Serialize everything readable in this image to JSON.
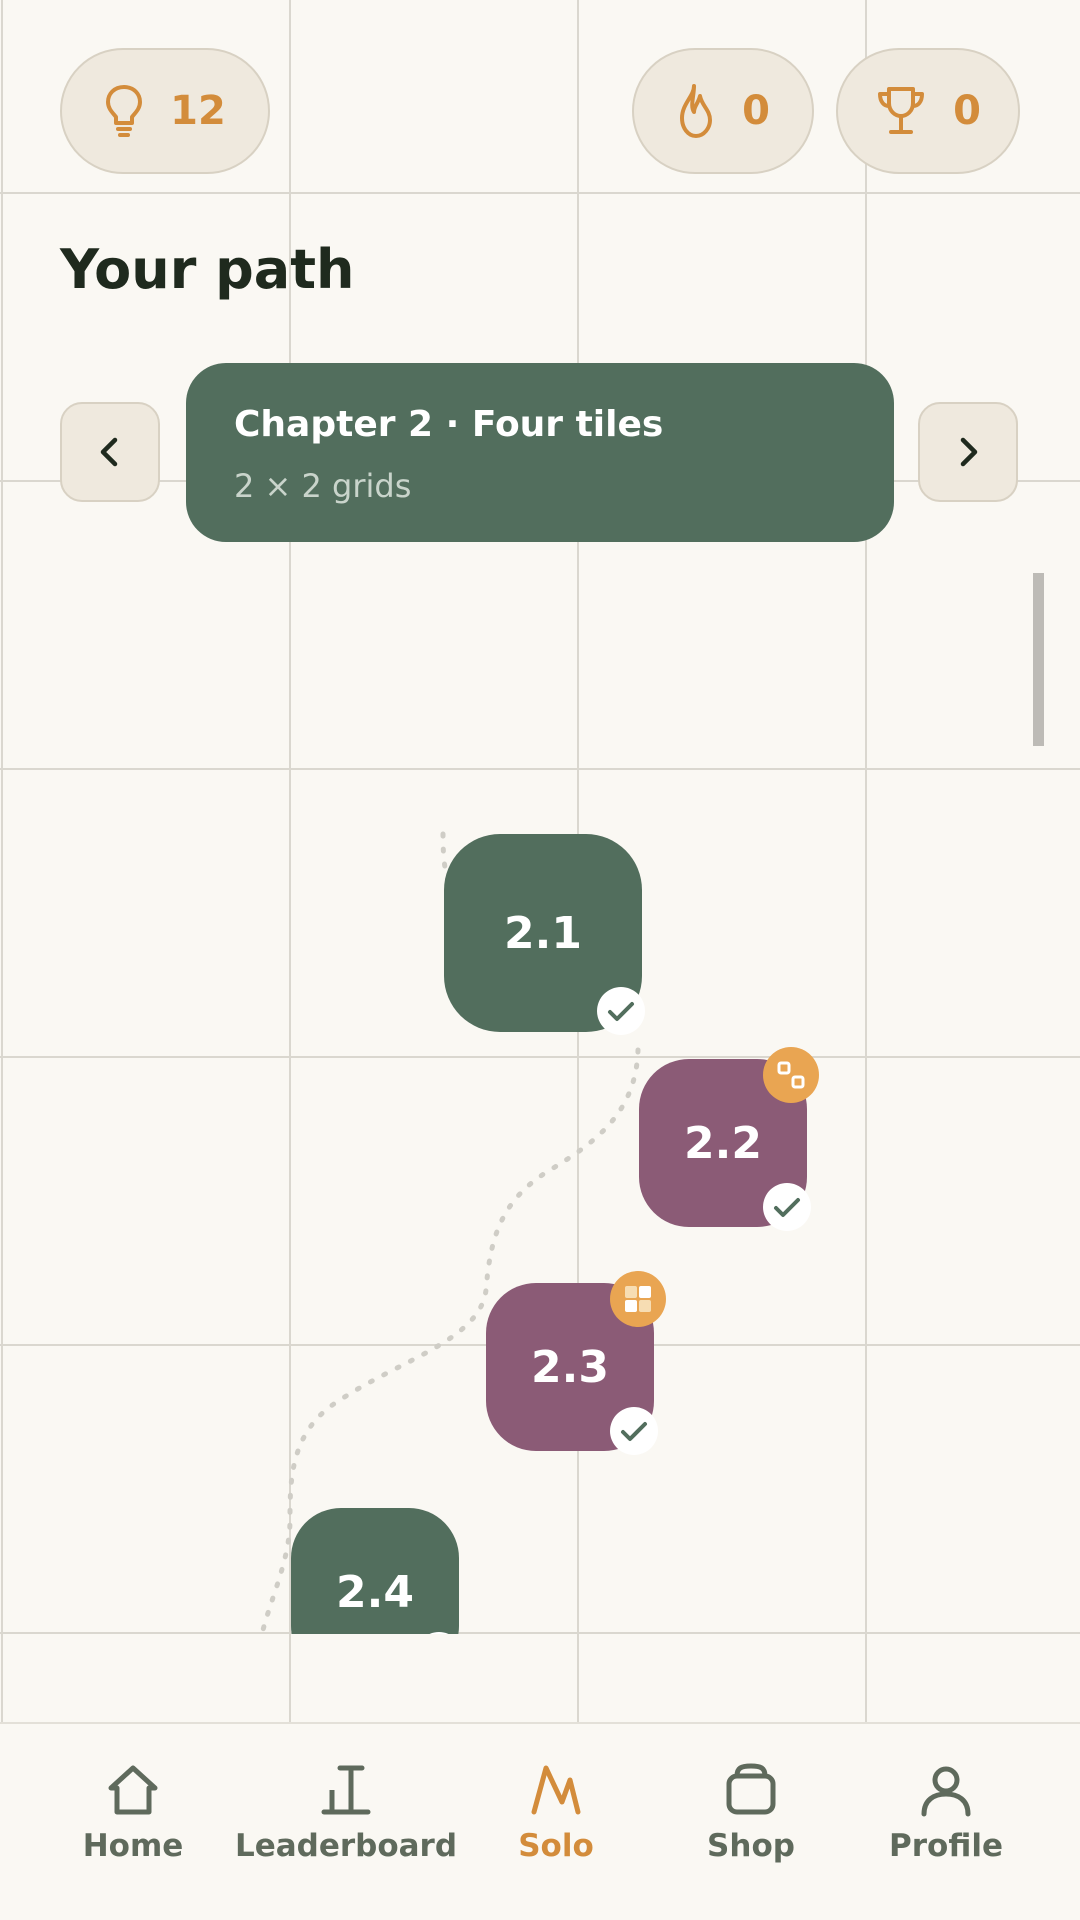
{
  "header": {
    "hints_count": "12",
    "streak_count": "0",
    "trophies_count": "0",
    "icons": [
      "lightbulb-icon",
      "flame-icon",
      "trophy-icon"
    ]
  },
  "page_title": "Your path",
  "chapter": {
    "title": "Chapter 2 · Four tiles",
    "subtitle": "2 × 2 grids"
  },
  "levels": [
    {
      "label": "2.1",
      "completed": true,
      "color": "#526e5d"
    },
    {
      "label": "2.2",
      "completed": true,
      "color": "#8b5b76",
      "badge": "pairs-icon"
    },
    {
      "label": "2.3",
      "completed": true,
      "color": "#8b5b76",
      "badge": "grid-icon"
    },
    {
      "label": "2.4",
      "completed": true,
      "color": "#526e5d"
    }
  ],
  "nav": {
    "items": [
      {
        "label": "Home",
        "icon": "home-icon"
      },
      {
        "label": "Leaderboard",
        "icon": "leaderboard-icon"
      },
      {
        "label": "Solo",
        "icon": "solo-icon",
        "active": true
      },
      {
        "label": "Shop",
        "icon": "shop-icon"
      },
      {
        "label": "Profile",
        "icon": "profile-icon"
      }
    ]
  },
  "colors": {
    "accent": "#d38c3b",
    "green": "#526e5d",
    "purple": "#8b5b76",
    "badge": "#e9a552",
    "text_dark": "#1f2a1e"
  }
}
